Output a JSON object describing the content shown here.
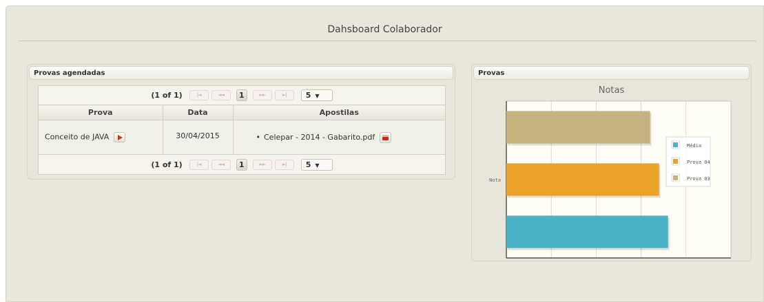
{
  "page": {
    "title": "Dahsboard Colaborador"
  },
  "provas_agendadas": {
    "title": "Provas agendadas",
    "paginator": {
      "count": "(1 of 1)",
      "first": "|◄",
      "prev": "◄◄",
      "page": "1",
      "next": "►►",
      "last": "►|",
      "rows_per_page": "5",
      "dropdown_arrow": "▼"
    },
    "columns": [
      "Prova",
      "Data",
      "Apostilas"
    ],
    "rows": [
      {
        "prova": "Conceito de JAVA",
        "data": "30/04/2015",
        "apostila": "Celepar - 2014 - Gabarito.pdf"
      }
    ],
    "bullet": "•",
    "icons": {
      "play": "play-icon",
      "download": "save-icon"
    }
  },
  "provas": {
    "title": "Provas",
    "chart_data": {
      "type": "bar",
      "orientation": "horizontal",
      "title": "Notas",
      "categories": [
        "Nota"
      ],
      "series": [
        {
          "name": "Média",
          "values": [
            90
          ],
          "color": "#4bb2c5"
        },
        {
          "name": "Prova 04",
          "values": [
            85
          ],
          "color": "#eaa228"
        },
        {
          "name": "Prova 03",
          "values": [
            80
          ],
          "color": "#c5b47f"
        }
      ],
      "xlim": [
        0,
        125
      ],
      "xticks": [
        "0",
        "25",
        "50",
        "75",
        "100",
        "125"
      ],
      "grid": true,
      "legend": "right"
    }
  }
}
